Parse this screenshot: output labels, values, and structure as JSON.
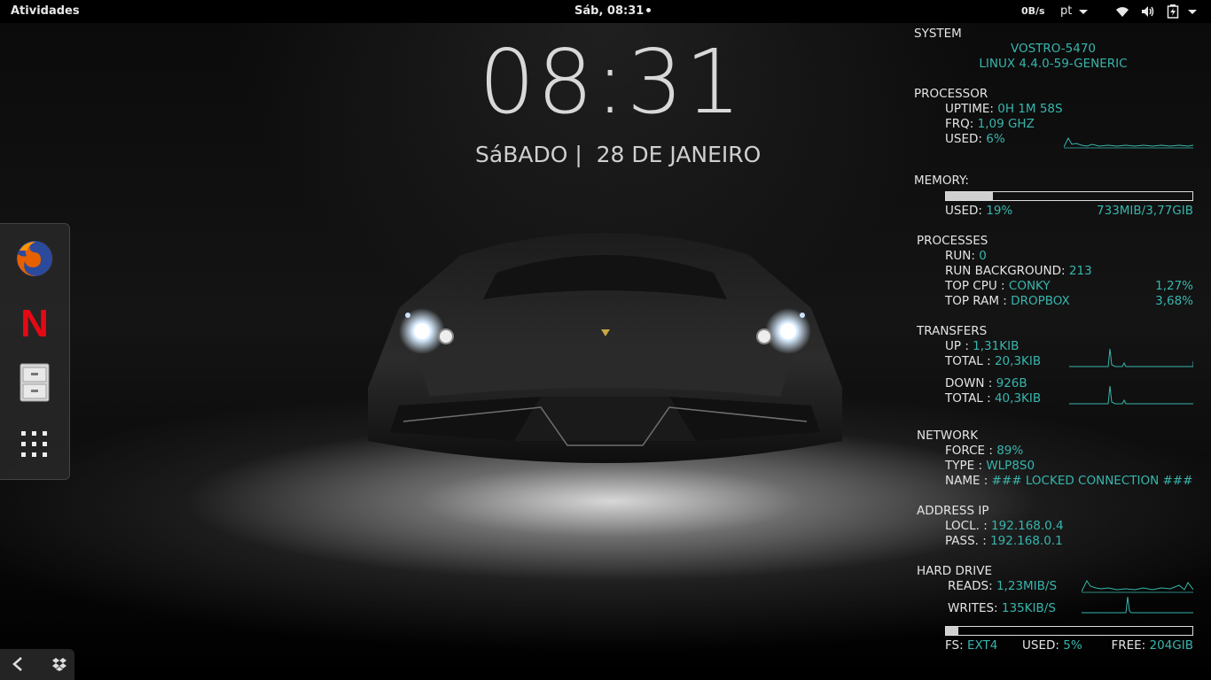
{
  "topbar": {
    "activities": "Atividades",
    "clock": "Sáb, 08:31",
    "net_speed": "0B/s",
    "language": "pt",
    "icons": [
      "wifi-icon",
      "volume-icon",
      "battery-icon"
    ]
  },
  "desktop": {
    "time": "08:31",
    "date": "SáBADO |  28 DE JANEIRO"
  },
  "dock": {
    "items": [
      "firefox-icon",
      "netflix-icon",
      "files-icon",
      "app-grid-icon"
    ],
    "netflix_letter": "N"
  },
  "tray": {
    "items": [
      "back-arrow-icon",
      "dropbox-icon"
    ]
  },
  "conky": {
    "accent_color": "#38b5ad",
    "system": {
      "header": "SYSTEM",
      "host": "VOSTRO-5470",
      "kernel": "LINUX 4.4.0-59-GENERIC"
    },
    "processor": {
      "header": "PROCESSOR",
      "uptime_label": "UPTIME:",
      "uptime": "0H 1M 58S",
      "frq_label": "FRQ:",
      "frq": "1,09 GHZ",
      "used_label": "USED:",
      "used": "6%"
    },
    "memory": {
      "header": "MEMORY:",
      "used_fraction": 0.19,
      "used_label": "USED:",
      "used": "19%",
      "amount": "733MIB/3,77GIB"
    },
    "processes": {
      "header": "PROCESSES",
      "run_label": "RUN:",
      "run": "0",
      "bg_label": "RUN BACKGROUND:",
      "bg": "213",
      "top_cpu_label": "TOP CPU  :",
      "top_cpu": "CONKY",
      "top_cpu_val": "1,27%",
      "top_ram_label": "TOP RAM  :",
      "top_ram": "DROPBOX",
      "top_ram_val": "3,68%"
    },
    "transfers": {
      "header": "TRANSFERS",
      "up_label": "UP   :",
      "up": "1,31KIB",
      "up_total_label": "TOTAL :",
      "up_total": "20,3KIB",
      "down_label": "DOWN  :",
      "down": "926B",
      "down_total_label": "TOTAL :",
      "down_total": "40,3KIB"
    },
    "network": {
      "header": "NETWORK",
      "force_label": "FORCE :",
      "force": "89%",
      "type_label": "TYPE  :",
      "type": "WLP8S0",
      "name_label": "NAME  :",
      "name": "### LOCKED CONNECTION ###"
    },
    "address": {
      "header": "ADDRESS IP",
      "local_label": "LOCL. :",
      "local": "192.168.0.4",
      "pass_label": "PASS. :",
      "pass": "192.168.0.1"
    },
    "hard_drive": {
      "header": "HARD DRIVE",
      "reads_label": "READS:",
      "reads": "1,23MIB/S",
      "writes_label": "WRITES:",
      "writes": "135KIB/S",
      "used_fraction": 0.05,
      "fs_label": "FS:",
      "fs": "EXT4",
      "used_label": "USED:",
      "used": "5%",
      "free_label": "FREE:",
      "free": "204GIB"
    }
  }
}
